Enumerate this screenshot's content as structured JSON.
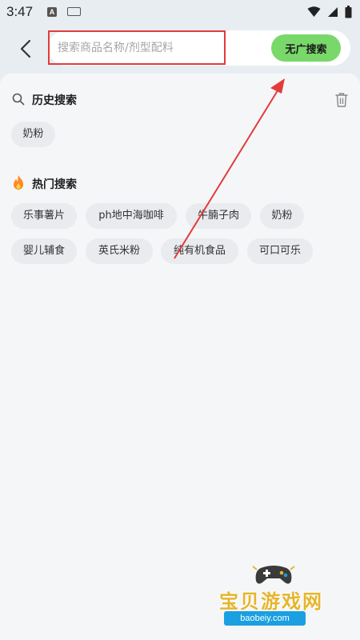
{
  "status_bar": {
    "time": "3:47",
    "icons": [
      "android-a-icon",
      "keyboard-icon",
      "wifi-icon",
      "signal-icon",
      "battery-icon"
    ]
  },
  "search": {
    "placeholder": "搜索商品名称/剂型配料",
    "value": "",
    "button_label": "无广搜索"
  },
  "history": {
    "title": "历史搜索",
    "items": [
      "奶粉"
    ]
  },
  "hot": {
    "title": "热门搜索",
    "items": [
      "乐事薯片",
      "ph地中海咖啡",
      "牛腩子肉",
      "奶粉",
      "婴儿辅食",
      "英氏米粉",
      "纯有机食品",
      "可口可乐"
    ]
  },
  "watermark": {
    "title": "宝贝游戏网",
    "url": "baobeiy.com"
  },
  "colors": {
    "accent_green": "#79d86a",
    "annotation_red": "#e33b3b",
    "background": "#e8edf2",
    "chip_bg": "#e9ebee"
  }
}
